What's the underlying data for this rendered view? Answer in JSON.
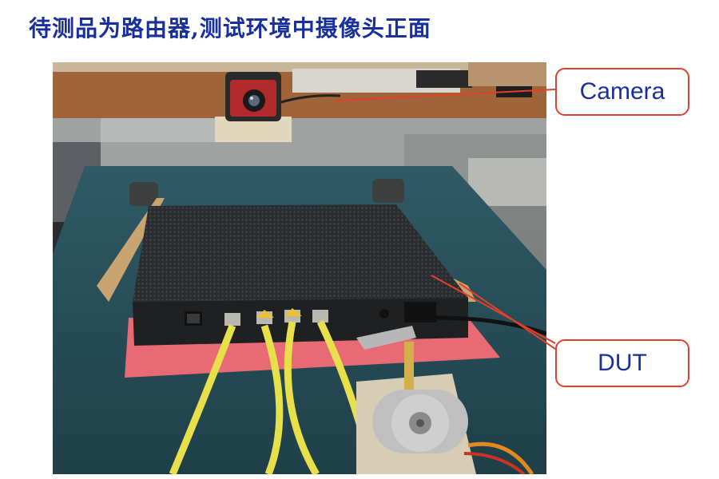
{
  "slide": {
    "title": "待测品为路由器,测试环境中摄像头正面"
  },
  "callouts": {
    "camera": "Camera",
    "dut": "DUT"
  },
  "colors": {
    "title": "#1a2f9e",
    "callout_border": "#e2402a",
    "callout_text": "#1a2f9e",
    "leader_line": "#e2402a"
  }
}
